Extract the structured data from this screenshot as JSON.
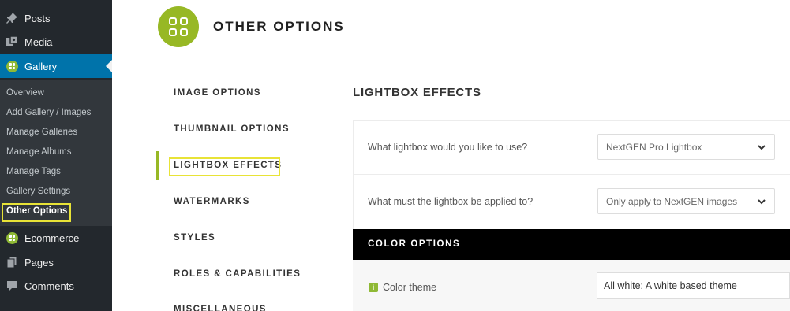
{
  "sidebar": {
    "menu": [
      {
        "label": "Posts",
        "icon": "pin-icon"
      },
      {
        "label": "Media",
        "icon": "media-icon"
      },
      {
        "label": "Gallery",
        "icon": "nextgen-gallery-icon"
      }
    ],
    "submenu": [
      "Overview",
      "Add Gallery / Images",
      "Manage Galleries",
      "Manage Albums",
      "Manage Tags",
      "Gallery Settings",
      "Other Options"
    ],
    "lower_menu": [
      {
        "label": "Ecommerce",
        "icon": "nextgen-ecommerce-icon"
      },
      {
        "label": "Pages",
        "icon": "pages-icon"
      },
      {
        "label": "Comments",
        "icon": "comments-icon"
      }
    ]
  },
  "page": {
    "title": "OTHER OPTIONS"
  },
  "tabs": [
    "IMAGE OPTIONS",
    "THUMBNAIL OPTIONS",
    "LIGHTBOX EFFECTS",
    "WATERMARKS",
    "STYLES",
    "ROLES & CAPABILITIES",
    "MISCELLANEOUS"
  ],
  "section": {
    "title": "LIGHTBOX EFFECTS",
    "lightbox_question": "What lightbox would you like to use?",
    "lightbox_value": "NextGEN Pro Lightbox",
    "apply_question": "What must the lightbox be applied to?",
    "apply_value": "Only apply to NextGEN images",
    "color_options_heading": "COLOR OPTIONS",
    "color_theme_label": "Color theme",
    "color_theme_value": "All white: A white based theme"
  },
  "colors": {
    "sidebar_bg": "#23282d",
    "active_menu": "#0073aa",
    "accent_green": "#97b825",
    "highlight_yellow": "#e8e337"
  }
}
